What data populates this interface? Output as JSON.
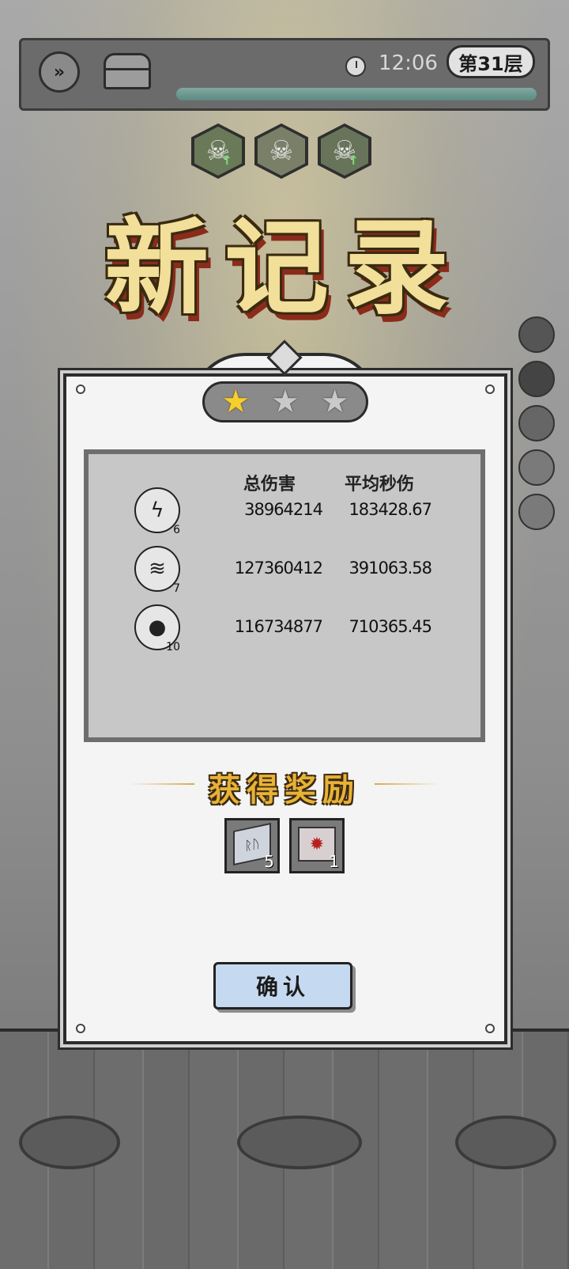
{
  "topbar": {
    "fast_forward_icon": "fast-forward-icon",
    "chest_icon": "treasure-chest-icon",
    "clock_icon": "clock-icon",
    "time": "12:06",
    "floor": "第31层",
    "progress": 1.0
  },
  "buff_icons": [
    "skull-up-icon",
    "skull-icon",
    "bone-skull-up-icon"
  ],
  "title": "新记录",
  "side_skills": [
    "lightning-skill-icon",
    "bomb-skill-icon",
    "drill-skill-icon",
    "empty-slot",
    "empty-slot"
  ],
  "result": {
    "stars": {
      "earned": 1,
      "total": 3
    },
    "headers": {
      "total_damage": "总伤害",
      "avg_dps": "平均秒伤"
    },
    "rows": [
      {
        "icon": "lightning-skill-icon",
        "level": "6",
        "total_damage": "38964214",
        "avg_dps": "183428.67"
      },
      {
        "icon": "drill-skill-icon",
        "level": "7",
        "total_damage": "127360412",
        "avg_dps": "391063.58"
      },
      {
        "icon": "bomb-skill-icon",
        "level": "10",
        "total_damage": "116734877",
        "avg_dps": "710365.45"
      }
    ],
    "reward_title": "获得奖励",
    "rewards": [
      {
        "icon": "rune-stone-icon",
        "count": "5"
      },
      {
        "icon": "red-gem-stone-icon",
        "count": "1"
      }
    ],
    "confirm_label": "确认"
  },
  "colors": {
    "star_on": "#f7cf2a",
    "title_gold": "#f1df9a",
    "reward_gold": "#e8b238",
    "confirm_bg": "#c5daf0"
  }
}
